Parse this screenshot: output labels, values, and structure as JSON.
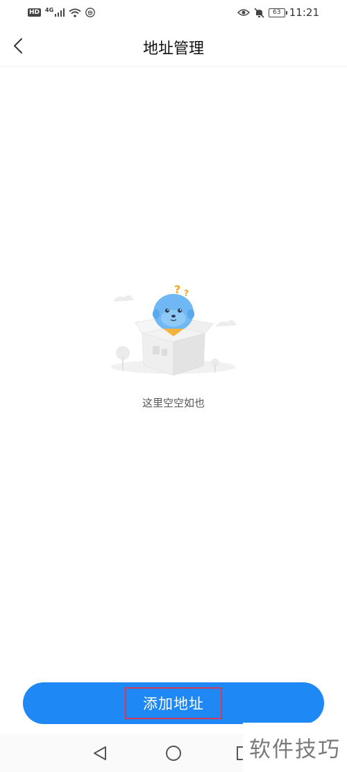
{
  "status_bar": {
    "left_icons": [
      "hd-badge",
      "4g-signal-icon",
      "wifi-icon",
      "hand-icon"
    ],
    "hd_label": "HD",
    "network_label": "4G",
    "right_icons": [
      "eye-icon",
      "mute-icon",
      "battery-icon"
    ],
    "battery_level": "63",
    "time": "11:21"
  },
  "header": {
    "title": "地址管理",
    "back_icon": "chevron-left-icon"
  },
  "empty_state": {
    "illustration": "mascot-in-box",
    "question_marks": "??",
    "message": "这里空空如也"
  },
  "footer": {
    "add_button_label": "添加地址",
    "accent_color": "#1e88f5"
  },
  "nav_bar": {
    "buttons": [
      "triangle-back-icon",
      "circle-home-icon",
      "square-recent-icon"
    ]
  },
  "watermark": {
    "text": "软件技巧"
  }
}
